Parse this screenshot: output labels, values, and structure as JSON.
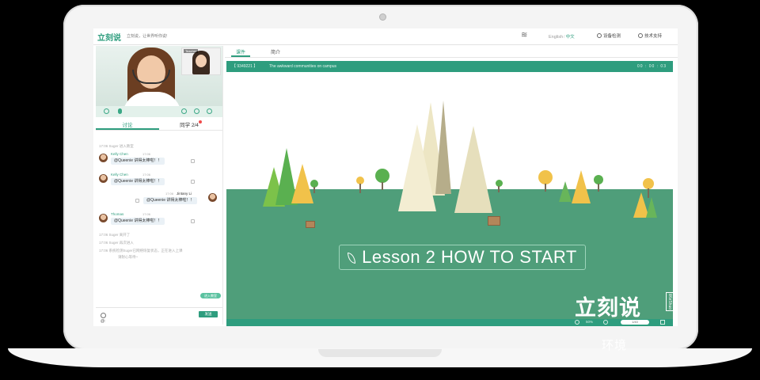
{
  "watermark": "环境",
  "topbar": {
    "logo": "立刻说",
    "slogan": "立刻说，让世界听你说!",
    "lang_en": "English",
    "lang_sep": "/",
    "lang_cn": "中文",
    "device_check": "设备检测",
    "tech_support": "技术支持"
  },
  "video": {
    "pip_name": "Teacher"
  },
  "left_tabs": {
    "discussion": "讨论",
    "classmates": "同学 2/4"
  },
  "chat": {
    "sys1": "17:06   Suger 进入教室",
    "messages": [
      {
        "name": "Kelly Chen",
        "time": "17:06",
        "text": "@Queenie 讲得太棒啦！！"
      },
      {
        "name": "Kelly Chen",
        "time": "17:06",
        "text": "@Queenie 讲得太棒啦！！"
      },
      {
        "name": "Jintany Li",
        "time": "17:06",
        "text": "@Queenie 讲得太棒啦！！"
      },
      {
        "name": "Thomas",
        "time": "17:06",
        "text": "@Queenie 讲得太棒啦！！"
      }
    ],
    "sys2": "17:06   Suger 离开了",
    "sys3": "17:06   Suger 再次进入",
    "sys4": "17:06   系统检测Suger已网络恢复状态，正在进入上课",
    "sys4b": "请耐心等待~",
    "reply_label": "进入教室",
    "input_text": "@:",
    "send_label": "发送"
  },
  "right_tabs": {
    "courseware": "课件",
    "intro": "简介"
  },
  "course": {
    "code": "【 9349221 】",
    "title": "The awkward communities on campus",
    "timer": "00 : 00 : 03",
    "lesson_title": "Lesson 2 HOW TO START",
    "brand": "立刻说",
    "brand_tag": "liKeShuo",
    "zoom": "50%",
    "page": "1/40"
  },
  "colors": {
    "accent": "#2e9d7e",
    "ground": "#4f9e7a"
  }
}
